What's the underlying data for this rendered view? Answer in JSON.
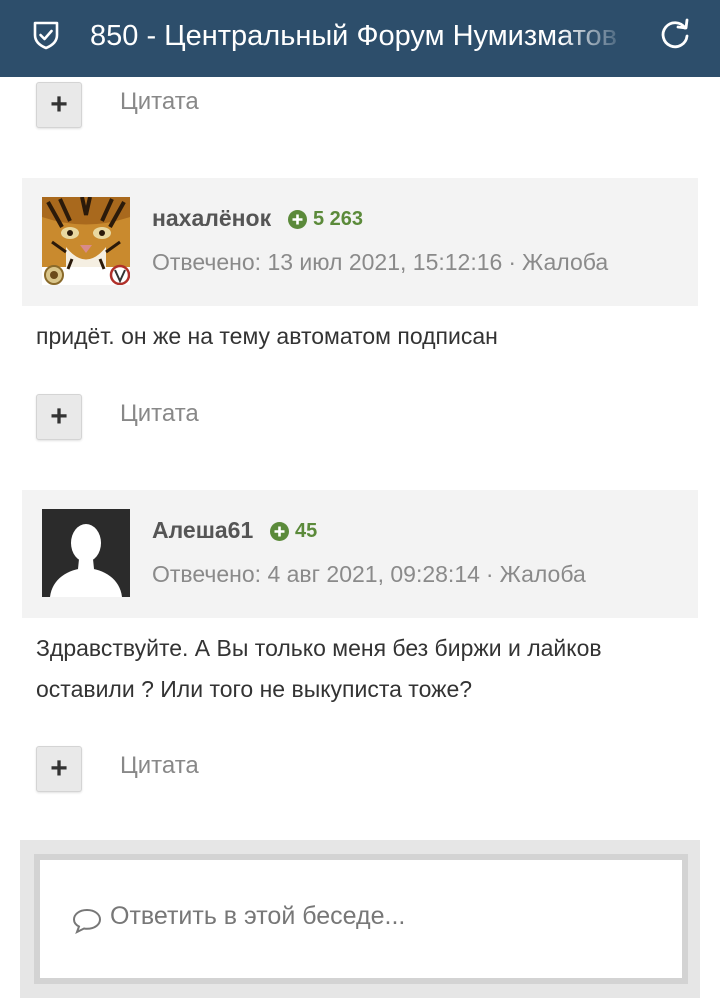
{
  "header": {
    "title": "850 - Центральный Форум Нумизматов",
    "left_icon": "shield-check-icon",
    "right_icon": "refresh-icon"
  },
  "quote_label": "Цитата",
  "posts": [
    {
      "author": "нахалёнок",
      "reputation": "5 263",
      "meta": "Отвечено: 13 июл 2021, 15:12:16",
      "separator": "·",
      "report": "Жалоба",
      "text": "придёт. он же на тему автоматом подписан"
    },
    {
      "author": "Алеша61",
      "reputation": "45",
      "meta": "Отвечено: 4 авг 2021, 09:28:14",
      "separator": "·",
      "report": "Жалоба",
      "text": "Здравствуйте. А Вы только меня без биржи и лайков оставили ? Или того не выкуписта тоже?"
    }
  ],
  "reply": {
    "placeholder": "Ответить в этой беседе..."
  },
  "colors": {
    "header_bg": "#2d4e6b",
    "reputation": "#5b8a3a",
    "post_header_bg": "#f3f3f3"
  }
}
